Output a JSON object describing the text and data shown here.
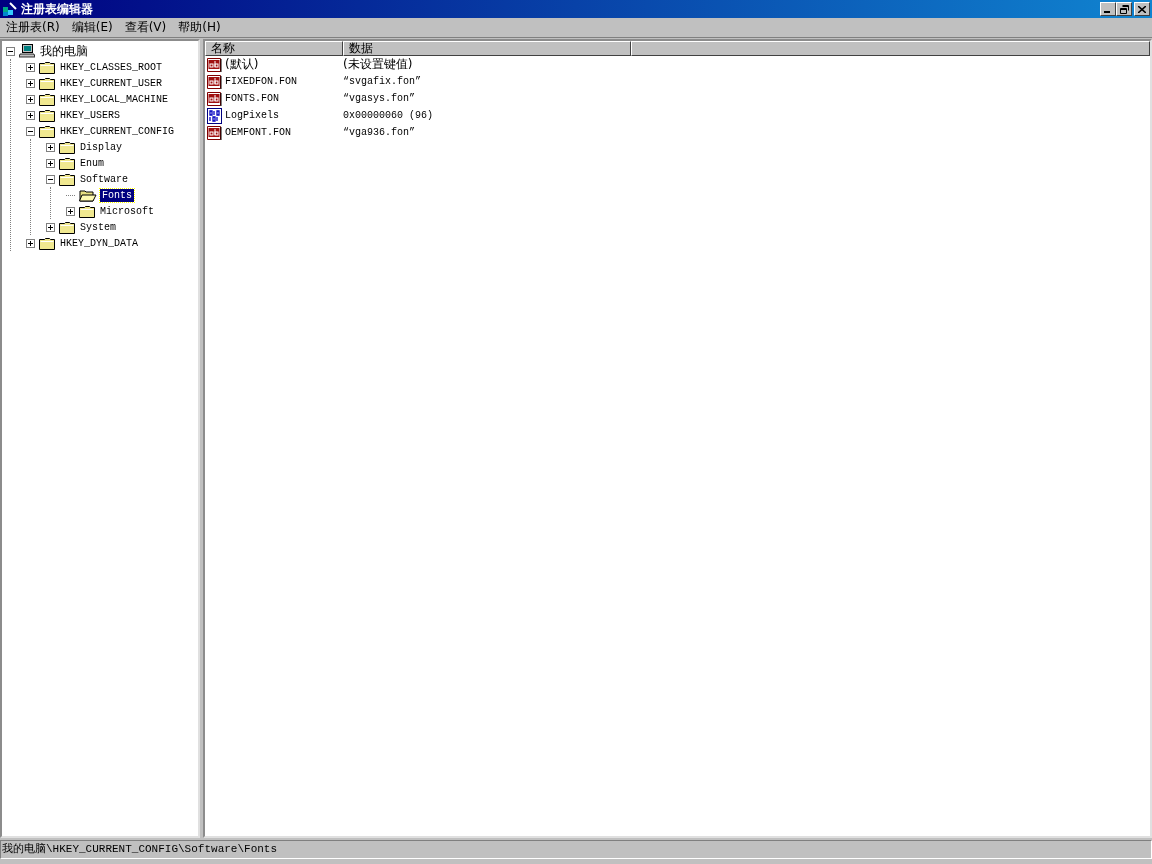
{
  "window": {
    "title": "注册表编辑器"
  },
  "menu": [
    "注册表(R)",
    "编辑(E)",
    "查看(V)",
    "帮助(H)"
  ],
  "tree": [
    {
      "label": "我的电脑",
      "kind": "computer",
      "expanded": true,
      "selected": false,
      "children": [
        {
          "label": "HKEY_CLASSES_ROOT",
          "kind": "folder",
          "expanded": false,
          "selected": false
        },
        {
          "label": "HKEY_CURRENT_USER",
          "kind": "folder",
          "expanded": false,
          "selected": false
        },
        {
          "label": "HKEY_LOCAL_MACHINE",
          "kind": "folder",
          "expanded": false,
          "selected": false
        },
        {
          "label": "HKEY_USERS",
          "kind": "folder",
          "expanded": false,
          "selected": false
        },
        {
          "label": "HKEY_CURRENT_CONFIG",
          "kind": "folder",
          "expanded": true,
          "selected": false,
          "children": [
            {
              "label": "Display",
              "kind": "folder",
              "expanded": false,
              "selected": false
            },
            {
              "label": "Enum",
              "kind": "folder",
              "expanded": false,
              "selected": false
            },
            {
              "label": "Software",
              "kind": "folder",
              "expanded": true,
              "selected": false,
              "children": [
                {
                  "label": "Fonts",
                  "kind": "folder",
                  "selected": true
                },
                {
                  "label": "Microsoft",
                  "kind": "folder",
                  "expanded": false,
                  "selected": false
                }
              ]
            },
            {
              "label": "System",
              "kind": "folder",
              "expanded": false,
              "selected": false
            }
          ]
        },
        {
          "label": "HKEY_DYN_DATA",
          "kind": "folder",
          "expanded": false,
          "selected": false
        }
      ]
    }
  ],
  "columns": [
    "名称",
    "数据"
  ],
  "values": [
    {
      "name": "(默认)",
      "data": "(未设置键值)",
      "kind": "string"
    },
    {
      "name": "FIXEDFON.FON",
      "data": "“svgafix.fon”",
      "kind": "string"
    },
    {
      "name": "FONTS.FON",
      "data": "“vgasys.fon”",
      "kind": "string"
    },
    {
      "name": "LogPixels",
      "data": "0x00000060 (96)",
      "kind": "binary"
    },
    {
      "name": "OEMFONT.FON",
      "data": "“vga936.fon”",
      "kind": "string"
    }
  ],
  "status_bar": "我的电脑\\HKEY_CURRENT_CONFIG\\Software\\Fonts"
}
